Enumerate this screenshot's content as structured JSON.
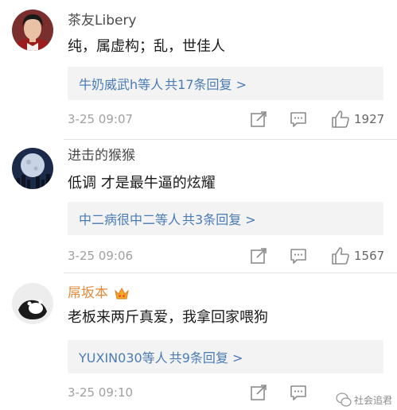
{
  "comments": [
    {
      "username": "茶友Libery",
      "content": "纯，属虚构；乱，世佳人",
      "reply_users": "牛奶威武h等人",
      "reply_count": "共17条回复 >",
      "timestamp": "3-25 09:07",
      "like_count": "1927",
      "avatar_icon": "portrait-avatar"
    },
    {
      "username": "进击的猴猴",
      "content": "低调 才是最牛逼的炫耀",
      "reply_users": "中二病很中二等人",
      "reply_count": "共3条回复 >",
      "timestamp": "3-25 09:06",
      "like_count": "1567",
      "avatar_icon": "moon-avatar"
    },
    {
      "username": "屌坂本",
      "content": "老板来两斤真爱，我拿回家喂狗",
      "reply_users": "YUXIN030等人",
      "reply_count": "共9条回复 >",
      "timestamp": "3-25 09:10",
      "like_count": "",
      "avatar_icon": "cat-paw-avatar",
      "badge_icon": "crown-badge-icon"
    }
  ],
  "watermark": {
    "text": "社会追君"
  },
  "colors": {
    "link": "#4a7bb5",
    "vip_name": "#e8883a",
    "meta": "#a0a0a0",
    "reply_bg": "#f3f3f3"
  }
}
